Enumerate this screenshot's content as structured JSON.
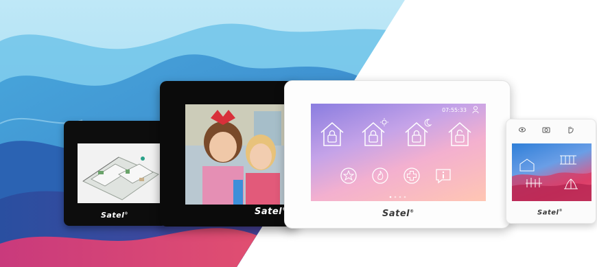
{
  "brand": {
    "small_black": "Satel",
    "big_black": "Satel",
    "big_white": "Satel",
    "small_white": "Satel",
    "mark": "®"
  },
  "big_white_screen": {
    "time": "07:55:33",
    "icons": [
      "house-lock-icon",
      "house-sun-lock-icon",
      "house-moon-lock-icon",
      "house-open-lock-icon",
      "panic-icon",
      "fire-icon",
      "medical-icon",
      "info-icon"
    ]
  },
  "small_white_screen": {
    "top_icons": [
      "eye-icon",
      "camera-icon",
      "hand-icon"
    ]
  },
  "colors": {
    "black_device": "#0b0b0b",
    "white_device": "#fdfdfd",
    "wave_light": "#8fd3ee",
    "wave_dark": "#2c5aa8",
    "wave_pink": "#e34a7f"
  }
}
